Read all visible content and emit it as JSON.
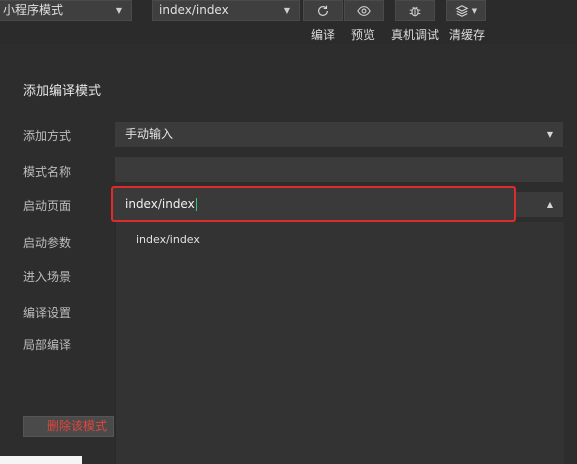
{
  "toolbar": {
    "mode_select": "小程序模式",
    "page_select": "index/index",
    "compile_label": "编译",
    "preview_label": "预览",
    "debug_label": "真机调试",
    "cache_label": "清缓存"
  },
  "panel": {
    "title": "添加编译模式",
    "labels": {
      "add_method": "添加方式",
      "mode_name": "模式名称",
      "launch_page": "启动页面",
      "launch_params": "启动参数",
      "scene": "进入场景",
      "compile_settings": "编译设置",
      "partial_compile": "局部编译"
    },
    "add_method_value": "手动输入",
    "mode_name_value": "",
    "launch_page_value": "index/index",
    "dropdown_items": [
      "index/index"
    ],
    "delete_label": "删除该模式"
  },
  "icons": {
    "compile": "refresh-icon",
    "preview": "eye-icon",
    "debug": "bug-icon",
    "cache": "layers-icon"
  }
}
